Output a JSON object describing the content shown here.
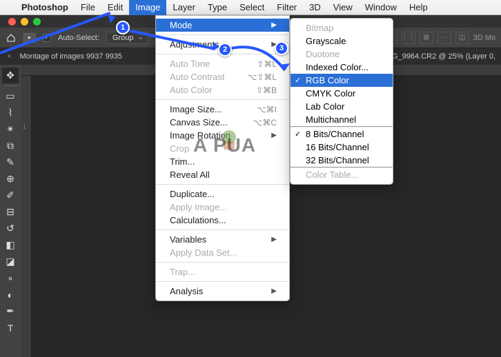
{
  "menubar": {
    "app": "Photoshop",
    "items": [
      "File",
      "Edit",
      "Image",
      "Layer",
      "Type",
      "Select",
      "Filter",
      "3D",
      "View",
      "Window",
      "Help"
    ],
    "highlighted": "Image"
  },
  "options": {
    "auto_select_label": "Auto-Select:",
    "auto_select_value": "Group",
    "mode_label": "3D Mo"
  },
  "tabs": {
    "left_tab": "Montage of images 9937 9935",
    "right_tab": "MG_9964.CR2 @ 25% (Layer 0,"
  },
  "image_menu": {
    "mode": "Mode",
    "adjustments": "Adjustments",
    "auto_tone": {
      "label": "Auto Tone",
      "shortcut": "⇧⌘L"
    },
    "auto_contrast": {
      "label": "Auto Contrast",
      "shortcut": "⌥⇧⌘L"
    },
    "auto_color": {
      "label": "Auto Color",
      "shortcut": "⇧⌘B"
    },
    "image_size": {
      "label": "Image Size...",
      "shortcut": "⌥⌘I"
    },
    "canvas_size": {
      "label": "Canvas Size...",
      "shortcut": "⌥⌘C"
    },
    "image_rotation": "Image Rotation",
    "crop": "Crop",
    "trim": "Trim...",
    "reveal_all": "Reveal All",
    "duplicate": "Duplicate...",
    "apply_image": "Apply Image...",
    "calculations": "Calculations...",
    "variables": "Variables",
    "apply_data_set": "Apply Data Set...",
    "trap": "Trap...",
    "analysis": "Analysis"
  },
  "mode_submenu": {
    "bitmap": "Bitmap",
    "grayscale": "Grayscale",
    "duotone": "Duotone",
    "indexed": "Indexed Color...",
    "rgb": "RGB Color",
    "cmyk": "CMYK Color",
    "lab": "Lab Color",
    "multichannel": "Multichannel",
    "bits8": "8 Bits/Channel",
    "bits16": "16 Bits/Channel",
    "bits32": "32 Bits/Channel",
    "color_table": "Color Table..."
  },
  "badges": {
    "b1": "1",
    "b2": "2",
    "b3": "3"
  },
  "watermark": "A   PUA",
  "ruler": {
    "mark": "1"
  }
}
